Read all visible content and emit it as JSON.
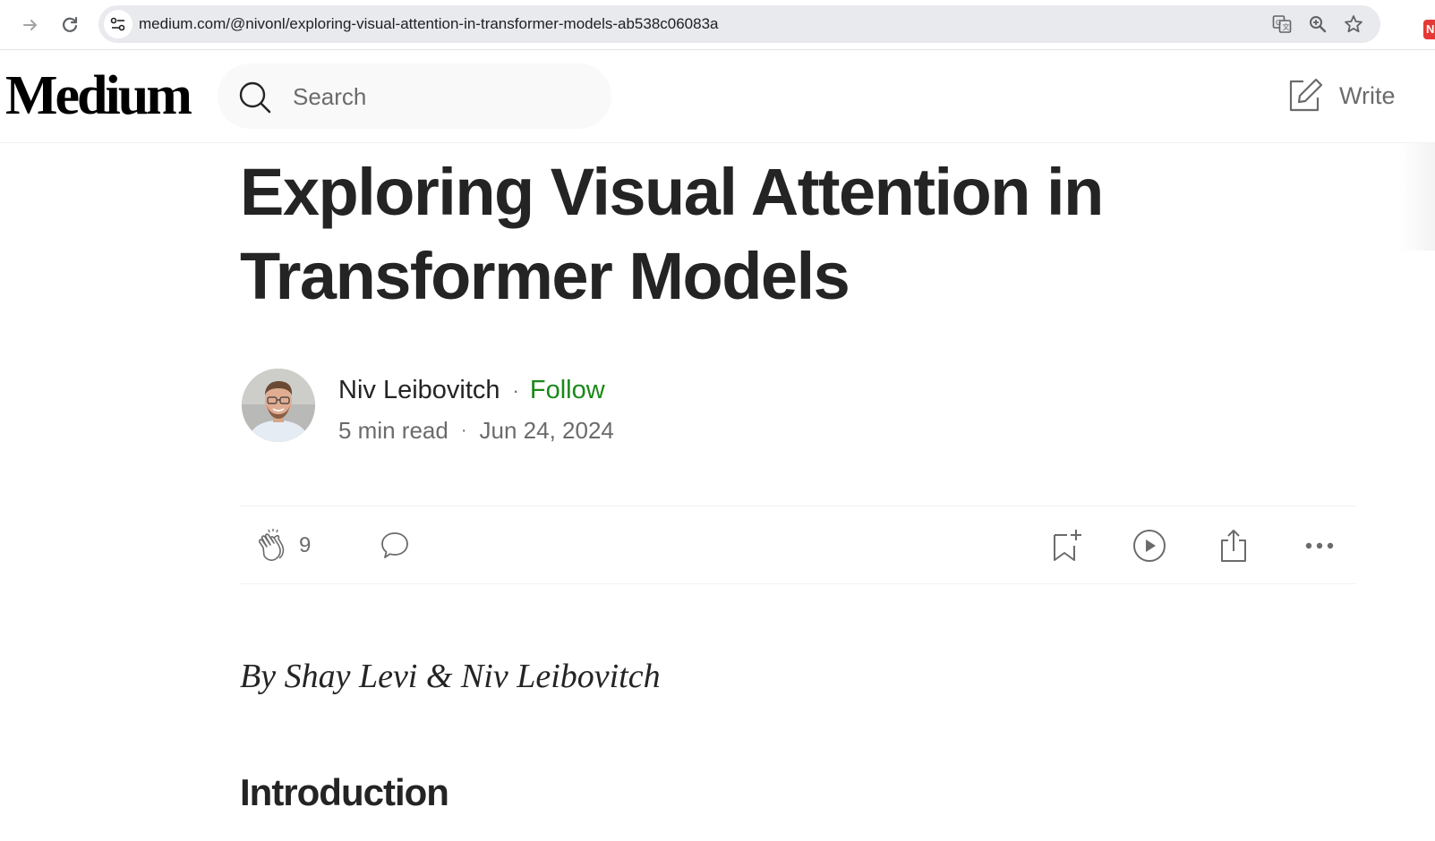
{
  "browser": {
    "url": "medium.com/@nivonl/exploring-visual-attention-in-transformer-models-ab538c06083a",
    "extension_badge": "N"
  },
  "header": {
    "logo": "Medium",
    "search_placeholder": "Search",
    "write_label": "Write"
  },
  "article": {
    "title": "Exploring Visual Attention in Transformer Models",
    "author": {
      "name": "Niv Leibovitch",
      "separator": "·",
      "follow_label": "Follow",
      "read_time": "5 min read",
      "date": "Jun 24, 2024"
    },
    "actions": {
      "clap_count": "9"
    },
    "byline": "By Shay Levi & Niv Leibovitch",
    "first_heading": "Introduction"
  },
  "colors": {
    "follow_green": "#1a8917",
    "text": "#242424",
    "muted": "#6b6b6b"
  },
  "icons": [
    "forward-arrow-icon",
    "reload-icon",
    "site-info-icon",
    "translate-icon",
    "zoom-icon",
    "star-icon",
    "search-icon",
    "write-icon",
    "clap-icon",
    "comment-icon",
    "bookmark-add-icon",
    "play-icon",
    "share-icon",
    "more-icon"
  ]
}
